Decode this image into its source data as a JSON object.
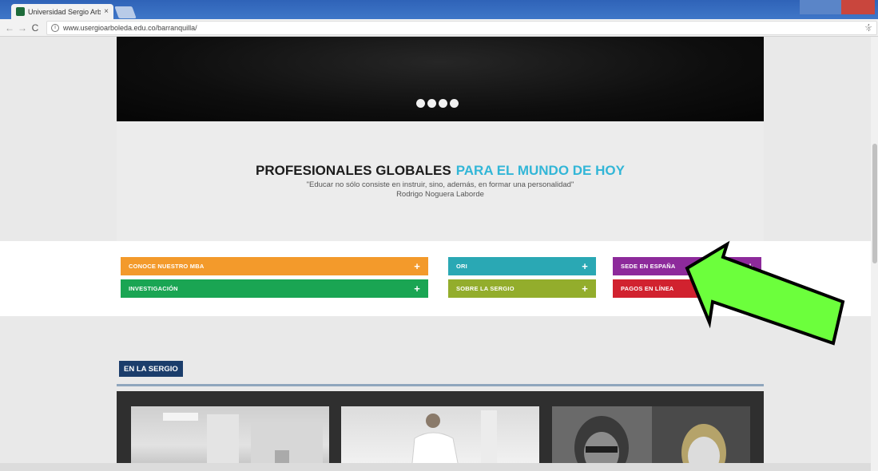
{
  "browser": {
    "tab_title": "Universidad Sergio Arbo",
    "tab_close": "×",
    "url": "www.usergioarboleda.edu.co/barranquilla/",
    "info_glyph": "i",
    "star_glyph": "☆",
    "menu_glyph": "⋮",
    "back_glyph": "←",
    "forward_glyph": "→",
    "reload_glyph": "C"
  },
  "slogan": {
    "headline_main": "PROFESIONALES GLOBALES",
    "headline_accent": "PARA EL MUNDO DE HOY",
    "quote": "\"Educar no sólo consiste en instruir, sino, además, en formar una personalidad\"",
    "author": "Rodrigo Noguera Laborde"
  },
  "quick_links": {
    "plus": "+",
    "items": [
      {
        "label": "CONOCE NUESTRO MBA",
        "color": "#f39a2b"
      },
      {
        "label": "INVESTIGACIÓN",
        "color": "#1aa553"
      },
      {
        "label": "ORI",
        "color": "#2aa8b4"
      },
      {
        "label": "SOBRE LA SERGIO",
        "color": "#93ad2c"
      },
      {
        "label": "SEDE EN ESPAÑA",
        "color": "#8d2a9b"
      },
      {
        "label": "PAGOS EN LÍNEA",
        "color": "#d1222f"
      }
    ]
  },
  "section": {
    "title": "EN LA SERGIO"
  },
  "colors": {
    "accent_blue": "#32b6d7",
    "arrow_green": "#6cff3c",
    "section_navy": "#1b3d6b"
  }
}
